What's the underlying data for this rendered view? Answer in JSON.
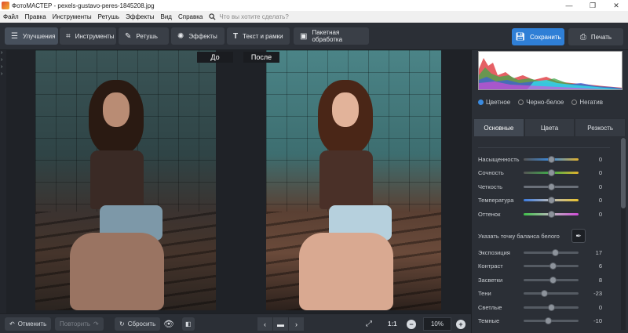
{
  "window": {
    "title": "ФотоМАСТЕР - pexels-gustavo-peres-1845208.jpg",
    "minimize": "—",
    "maximize": "❐",
    "close": "✕"
  },
  "menu": {
    "items": [
      "Файл",
      "Правка",
      "Инструменты",
      "Ретушь",
      "Эффекты",
      "Вид",
      "Справка"
    ],
    "search_placeholder": "Что вы хотите сделать?"
  },
  "toolbar": {
    "tabs": [
      {
        "label": "Улучшения",
        "icon": "sliders-icon"
      },
      {
        "label": "Инструменты",
        "icon": "crop-icon"
      },
      {
        "label": "Ретушь",
        "icon": "brush-icon"
      },
      {
        "label": "Эффекты",
        "icon": "sparkle-icon"
      },
      {
        "label": "Текст и рамки",
        "icon": "text-icon"
      },
      {
        "label": "Пакетная обработка",
        "icon": "batch-icon"
      }
    ],
    "save_label": "Сохранить",
    "print_label": "Печать"
  },
  "canvas": {
    "before_label": "До",
    "after_label": "После"
  },
  "panel": {
    "modes": [
      "Цветное",
      "Черно-белое",
      "Негатив"
    ],
    "tabs": [
      "Основные",
      "Цвета",
      "Резкость"
    ],
    "sliders_top": [
      {
        "name": "Насыщенность",
        "value": "0",
        "level": 0.5
      },
      {
        "name": "Сочность",
        "value": "0",
        "level": 0.5
      },
      {
        "name": "Четкость",
        "value": "0",
        "level": 0.5
      },
      {
        "name": "Температура",
        "value": "0",
        "level": 0.5
      },
      {
        "name": "Оттенок",
        "value": "0",
        "level": 0.5
      }
    ],
    "balance_label": "Указать точку баланса белого",
    "sliders_bottom": [
      {
        "name": "Экспозиция",
        "value": "17",
        "level": 0.585
      },
      {
        "name": "Контраст",
        "value": "6",
        "level": 0.53
      },
      {
        "name": "Засветки",
        "value": "8",
        "level": 0.54
      },
      {
        "name": "Тени",
        "value": "-23",
        "level": 0.385
      },
      {
        "name": "Светлые",
        "value": "0",
        "level": 0.5
      },
      {
        "name": "Темные",
        "value": "-10",
        "level": 0.45
      }
    ]
  },
  "bottom": {
    "undo_label": "Отменить",
    "redo_label": "Повторить",
    "reset_label": "Сбросить",
    "ratio_label": "1:1",
    "zoom_value": "10%"
  },
  "colors": {
    "accent": "#2f7fd6",
    "background": "#2b2f36"
  }
}
